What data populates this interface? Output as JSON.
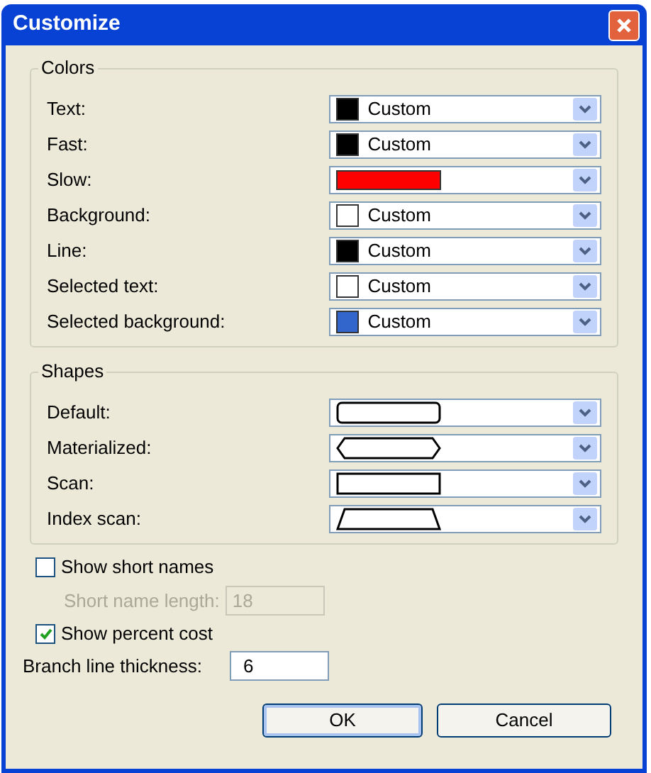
{
  "window": {
    "title": "Customize"
  },
  "colors": {
    "title": "Colors",
    "rows": [
      {
        "label": "Text:",
        "kind": "named",
        "color": "#000000",
        "value": "Custom"
      },
      {
        "label": "Fast:",
        "kind": "named",
        "color": "#000000",
        "value": "Custom"
      },
      {
        "label": "Slow:",
        "kind": "bar",
        "color": "#ff0000"
      },
      {
        "label": "Background:",
        "kind": "named",
        "color": "#ffffff",
        "value": "Custom"
      },
      {
        "label": "Line:",
        "kind": "named",
        "color": "#000000",
        "value": "Custom"
      },
      {
        "label": "Selected text:",
        "kind": "named",
        "color": "#ffffff",
        "value": "Custom"
      },
      {
        "label": "Selected background:",
        "kind": "named",
        "color": "#3366cc",
        "value": "Custom"
      }
    ]
  },
  "shapes": {
    "title": "Shapes",
    "rows": [
      {
        "label": "Default:",
        "kind": "rounded"
      },
      {
        "label": "Materialized:",
        "kind": "hexagon"
      },
      {
        "label": "Scan:",
        "kind": "rectangle"
      },
      {
        "label": "Index scan:",
        "kind": "trapezoid"
      }
    ]
  },
  "show_short_names": {
    "label": "Show short names",
    "checked": false
  },
  "short_name_length": {
    "label": "Short name length:",
    "value": "18",
    "disabled": true
  },
  "show_percent_cost": {
    "label": "Show percent cost",
    "checked": true
  },
  "branch_line_thickness": {
    "label": "Branch line thickness:",
    "value": "6"
  },
  "buttons": [
    {
      "label": "OK",
      "default": true
    },
    {
      "label": "Cancel",
      "default": false
    }
  ]
}
